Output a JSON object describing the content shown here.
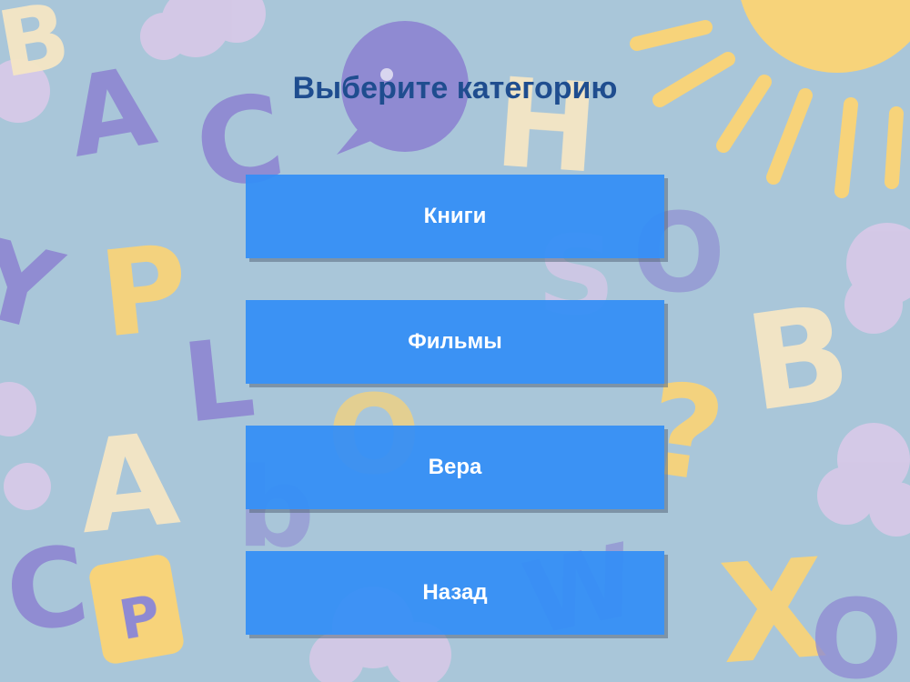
{
  "screen": {
    "title": "Выберите категорию"
  },
  "menu": {
    "books_label": "Книги",
    "movies_label": "Фильмы",
    "faith_label": "Вера",
    "back_label": "Назад"
  },
  "theme": {
    "background": "#a9c6d9",
    "button": "#348ef5",
    "title_color": "#1f4d8f",
    "letter_purple": "#8f8ad2",
    "letter_yellow": "#f7d37a",
    "letter_cream": "#f5e6c4",
    "cloud_lilac": "#d8c9e8"
  }
}
